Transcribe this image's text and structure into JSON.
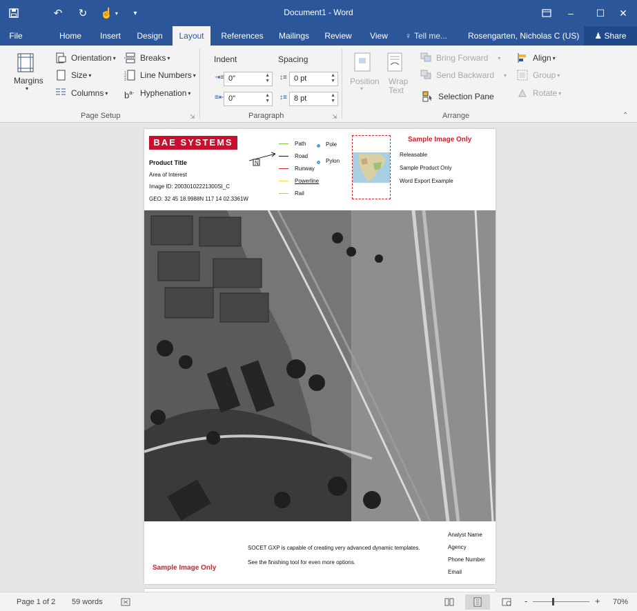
{
  "window": {
    "title": "Document1 - Word",
    "qat": {
      "save_icon": "save-icon",
      "undo_icon": "undo-icon",
      "redo_icon": "redo-icon",
      "touch_icon": "touch-mode-icon",
      "customize_icon": "customize-qat-icon"
    },
    "controls": {
      "ribbon_display_icon": "ribbon-display-options-icon",
      "minimize": "–",
      "maximize": "☐",
      "close": "✕"
    }
  },
  "tabs": [
    {
      "label": "File"
    },
    {
      "label": "Home"
    },
    {
      "label": "Insert"
    },
    {
      "label": "Design"
    },
    {
      "label": "Layout"
    },
    {
      "label": "References"
    },
    {
      "label": "Mailings"
    },
    {
      "label": "Review"
    },
    {
      "label": "View"
    }
  ],
  "active_tab": "Layout",
  "tell_me": "Tell me...",
  "user": "Rosengarten, Nicholas C (US)",
  "share": "Share",
  "ribbon": {
    "page_setup": {
      "margins": "Margins",
      "orientation": "Orientation",
      "size": "Size",
      "columns": "Columns",
      "breaks": "Breaks",
      "line_numbers": "Line Numbers",
      "hyphenation": "Hyphenation",
      "label": "Page Setup"
    },
    "paragraph": {
      "indent": "Indent",
      "spacing": "Spacing",
      "indent_left": "0\"",
      "indent_right": "0\"",
      "spacing_before": "0 pt",
      "spacing_after": "8 pt",
      "label": "Paragraph"
    },
    "arrange": {
      "position": "Position",
      "wrap_text_1": "Wrap",
      "wrap_text_2": "Text",
      "bring_forward": "Bring Forward",
      "send_backward": "Send Backward",
      "selection_pane": "Selection Pane",
      "align": "Align",
      "group": "Group",
      "rotate": "Rotate",
      "label": "Arrange"
    }
  },
  "document": {
    "logo": "BAE SYSTEMS",
    "product_title": "Product Title",
    "area_of_interest": "Area of Interest",
    "image_id": "Image ID: 20030102221300SI_C",
    "geo": "GEO: 32 45 18.9988N 117 14 02.3361W",
    "legend": {
      "path": "Path",
      "road": "Road",
      "runway": "Runway",
      "powerline": "Powerline",
      "rail": "Rail",
      "pole": "Pole",
      "pylon": "Pylon"
    },
    "sample_title": "Sample Image Only",
    "releasable": "Releasable",
    "sample_product": "Sample Product Only",
    "word_export": "Word Export Example",
    "footer_line1": "SOCET GXP is capable of creating very advanced dynamic templates.",
    "footer_line2": "See the finishing tool for even more options.",
    "footer_sample": "Sample Image Only",
    "analyst_name": "Analyst Name",
    "agency": "Agency",
    "phone": "Phone Number",
    "email": "Email",
    "colors": {
      "brand_red": "#c8102e",
      "path": "#7ac943",
      "road": "#111111",
      "runway": "#d0202a",
      "powerline": "#f2e04a",
      "rail": "#c9b79c",
      "pole": "#3aa7e6"
    }
  },
  "status": {
    "page": "Page 1 of 2",
    "words": "59 words",
    "zoom": "70%",
    "zoom_minus": "-",
    "zoom_plus": "+"
  }
}
